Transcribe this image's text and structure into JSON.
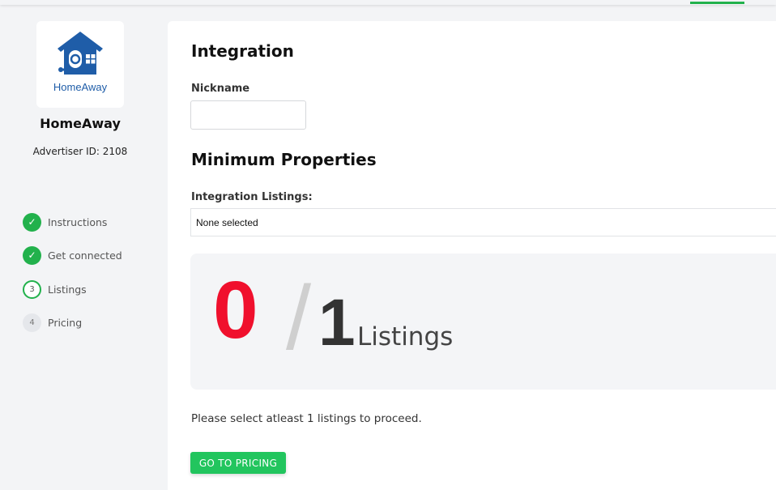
{
  "colors": {
    "accent": "#22b14c",
    "button": "#22c55e",
    "count_selected": "#f0102d",
    "logo_blue": "#1f5da8"
  },
  "sidebar": {
    "logo_icon": "homeaway-house-icon",
    "logo_text": "HomeAway",
    "brand_name": "HomeAway",
    "advertiser_id": "Advertiser ID: 2108",
    "steps": [
      {
        "marker": "✓",
        "label": "Instructions",
        "state": "done"
      },
      {
        "marker": "✓",
        "label": "Get connected",
        "state": "done"
      },
      {
        "marker": "3",
        "label": "Listings",
        "state": "current"
      },
      {
        "marker": "4",
        "label": "Pricing",
        "state": "pending"
      }
    ]
  },
  "main": {
    "integration_title": "Integration",
    "nickname_label": "Nickname",
    "nickname_value": "",
    "min_properties_title": "Minimum Properties",
    "listings_label": "Integration Listings:",
    "listings_selected": "None selected",
    "count": {
      "selected": "0",
      "slash": "/",
      "required": "1",
      "unit": "Listings"
    },
    "helper_text": "Please select atleast 1 listings to proceed.",
    "go_button": "GO TO PRICING"
  }
}
